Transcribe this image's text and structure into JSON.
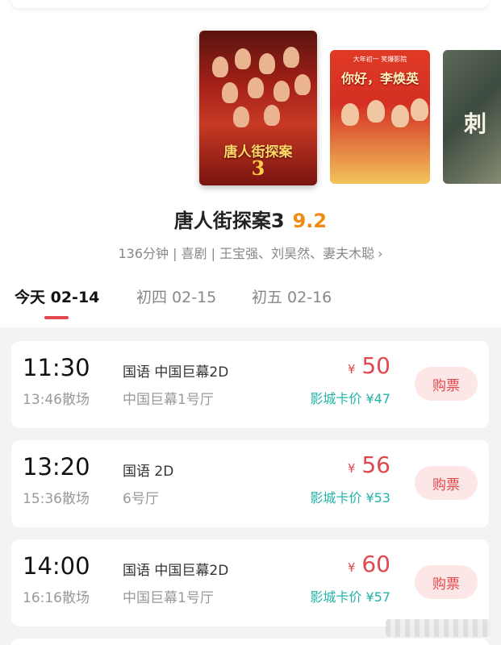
{
  "carousel": {
    "posters": [
      {
        "art_title": "唐人街探案",
        "art_number": "3"
      },
      {
        "art_tag": "大年初一 笑爆影院",
        "art_title": "你好，李焕英"
      },
      {
        "art_title": "刺"
      }
    ]
  },
  "movie": {
    "title": "唐人街探案3",
    "score": "9.2",
    "meta": "136分钟 | 喜剧 | 王宝强、刘昊然、妻夫木聪",
    "meta_chevron": "›"
  },
  "date_tabs": [
    {
      "label": "今天 02-14",
      "active": true
    },
    {
      "label": "初四 02-15",
      "active": false
    },
    {
      "label": "初五 02-16",
      "active": false
    }
  ],
  "showtimes": [
    {
      "start": "11:30",
      "end": "13:46散场",
      "lang_format": "国语 中国巨幕2D",
      "hall": "中国巨幕1号厅",
      "currency": "¥",
      "price": "50",
      "member_price": "影城卡价 ¥47",
      "buy_label": "购票"
    },
    {
      "start": "13:20",
      "end": "15:36散场",
      "lang_format": "国语 2D",
      "hall": "6号厅",
      "currency": "¥",
      "price": "56",
      "member_price": "影城卡价 ¥53",
      "buy_label": "购票"
    },
    {
      "start": "14:00",
      "end": "16:16散场",
      "lang_format": "国语 中国巨幕2D",
      "hall": "中国巨幕1号厅",
      "currency": "¥",
      "price": "60",
      "member_price": "影城卡价 ¥57",
      "buy_label": "购票"
    }
  ],
  "colors": {
    "accent_red": "#e2474d",
    "score_orange": "#f08c14",
    "member_teal": "#21b4a8",
    "buy_bg": "#fde6e6",
    "list_bg": "#f3f3f3"
  }
}
